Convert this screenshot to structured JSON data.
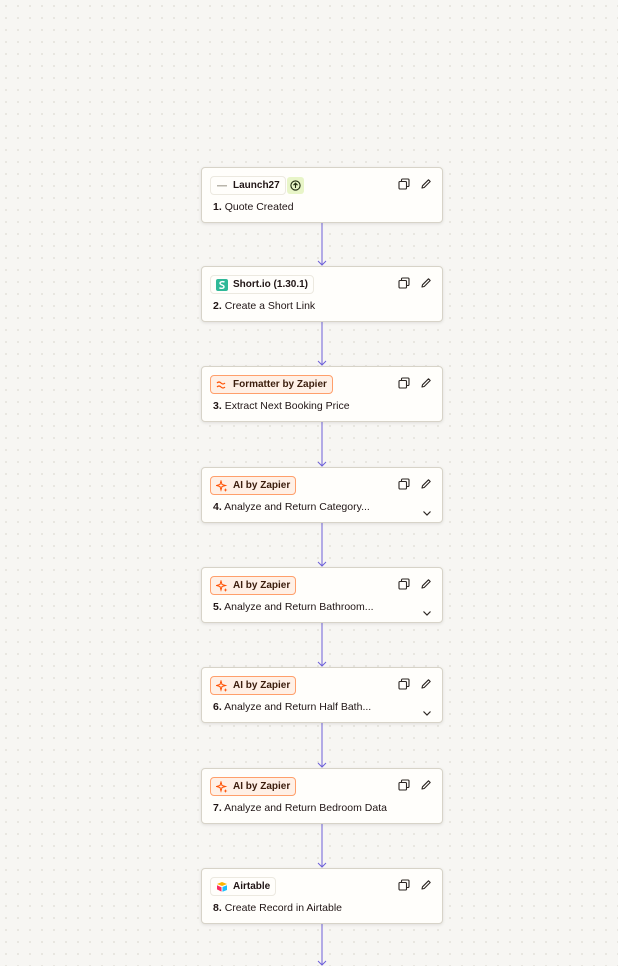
{
  "steps": [
    {
      "app": "Launch27",
      "num": "1.",
      "title": "Quote Created",
      "style": "plain",
      "icon": "launch27-icon",
      "trigger": true,
      "chevron": false
    },
    {
      "app": "Short.io (1.30.1)",
      "num": "2.",
      "title": "Create a Short Link",
      "style": "plain",
      "icon": "shortio-icon",
      "trigger": false,
      "chevron": false
    },
    {
      "app": "Formatter by Zapier",
      "num": "3.",
      "title": "Extract Next Booking Price",
      "style": "orange",
      "icon": "formatter-icon",
      "trigger": false,
      "chevron": false
    },
    {
      "app": "AI by Zapier",
      "num": "4.",
      "title": "Analyze and Return Category...",
      "style": "orange",
      "icon": "ai-sparkle-icon",
      "trigger": false,
      "chevron": true
    },
    {
      "app": "AI by Zapier",
      "num": "5.",
      "title": "Analyze and Return Bathroom...",
      "style": "orange",
      "icon": "ai-sparkle-icon",
      "trigger": false,
      "chevron": true
    },
    {
      "app": "AI by Zapier",
      "num": "6.",
      "title": "Analyze and Return Half Bath...",
      "style": "orange",
      "icon": "ai-sparkle-icon",
      "trigger": false,
      "chevron": true
    },
    {
      "app": "AI by Zapier",
      "num": "7.",
      "title": "Analyze and Return Bedroom Data",
      "style": "orange",
      "icon": "ai-sparkle-icon",
      "trigger": false,
      "chevron": false
    },
    {
      "app": "Airtable",
      "num": "8.",
      "title": "Create Record in Airtable",
      "style": "plain",
      "icon": "airtable-icon",
      "trigger": false,
      "chevron": false
    }
  ],
  "colors": {
    "connector": "#6d5fd9",
    "orange_border": "#ff9f6b",
    "orange_fill": "#fff0e6"
  },
  "icons": {
    "copy": "copy-icon",
    "edit": "edit-pencil-icon",
    "trigger": "trigger-indicator-icon",
    "expand": "chevron-down-icon"
  }
}
